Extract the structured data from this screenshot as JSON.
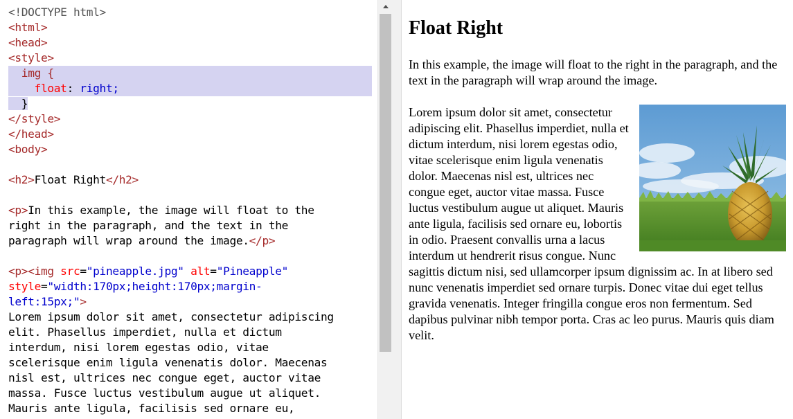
{
  "editor": {
    "lines": {
      "l1": "<!DOCTYPE html>",
      "l2": "<html>",
      "l3": "<head>",
      "l4": "<style>",
      "l5_sel": "img {",
      "l6_prop": "float",
      "l6_colon": ": ",
      "l6_val": "right;",
      "l7": "}",
      "l8": "</style>",
      "l9": "</head>",
      "l10": "<body>",
      "l12_open": "<h2>",
      "l12_text": "Float Right",
      "l12_close": "</h2>",
      "l14_open": "<p>",
      "l14_text": "In this example, the image will float to the",
      "l15_text": "right in the paragraph, and the text in the",
      "l16_text": "paragraph will wrap around the image.",
      "l16_close": "</p>",
      "l18_p": "<p>",
      "l18_img": "<img ",
      "l18_src_attr": "src",
      "l18_src_val": "\"pineapple.jpg\"",
      "l18_alt_attr": "alt",
      "l18_alt_val": "\"Pineapple\"",
      "l19_style_attr": "style",
      "l19_style_val": "\"width:170px;height:170px;margin-",
      "l20_style_val": "left:15px;\"",
      "l20_close": ">",
      "l21": "Lorem ipsum dolor sit amet, consectetur adipiscing",
      "l22": "elit. Phasellus imperdiet, nulla et dictum",
      "l23": "interdum, nisi lorem egestas odio, vitae",
      "l24": "scelerisque enim ligula venenatis dolor. Maecenas",
      "l25": "nisl est, ultrices nec congue eget, auctor vitae",
      "l26": "massa. Fusce luctus vestibulum augue ut aliquet.",
      "l27": "Mauris ante ligula, facilisis sed ornare eu,"
    }
  },
  "preview": {
    "title": "Float Right",
    "intro": "In this example, the image will float to the right in the paragraph, and the text in the paragraph will wrap around the image.",
    "image_alt": "Pineapple",
    "lorem": "Lorem ipsum dolor sit amet, consectetur adipiscing elit. Phasellus imperdiet, nulla et dictum interdum, nisi lorem egestas odio, vitae scelerisque enim ligula venenatis dolor. Maecenas nisl est, ultrices nec congue eget, auctor vitae massa. Fusce luctus vestibulum augue ut aliquet. Mauris ante ligula, facilisis sed ornare eu, lobortis in odio. Praesent convallis urna a lacus interdum ut hendrerit risus congue. Nunc sagittis dictum nisi, sed ullamcorper ipsum dignissim ac. In at libero sed nunc venenatis imperdiet sed ornare turpis. Donec vitae dui eget tellus gravida venenatis. Integer fringilla congue eros non fermentum. Sed dapibus pulvinar nibh tempor porta. Cras ac leo purus. Mauris quis diam velit."
  },
  "colors": {
    "tag": "#a52a2a",
    "attribute": "#ff0000",
    "value": "#0000cd",
    "highlight": "#d5d3f1",
    "scrollbar_thumb": "#c1c1c1"
  }
}
